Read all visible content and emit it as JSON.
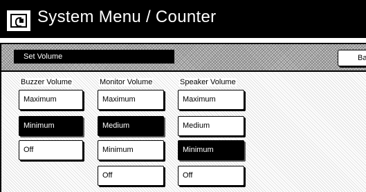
{
  "titlebar": {
    "title": "System Menu / Counter",
    "icon": "copier-icon"
  },
  "header": {
    "section_label": "Set Volume",
    "back_label": "Ba"
  },
  "columns": [
    {
      "label": "Buzzer Volume",
      "options": [
        "Maximum",
        "Minimum",
        "Off"
      ],
      "selected": "Minimum"
    },
    {
      "label": "Monitor Volume",
      "options": [
        "Maximum",
        "Medium",
        "Minimum",
        "Off"
      ],
      "selected": "Medium"
    },
    {
      "label": "Speaker Volume",
      "options": [
        "Maximum",
        "Medium",
        "Minimum",
        "Off"
      ],
      "selected": "Minimum"
    }
  ],
  "colors": {
    "titlebar_bg": "#000000",
    "selected_bg": "#000000",
    "selected_text": "#ffffff"
  }
}
